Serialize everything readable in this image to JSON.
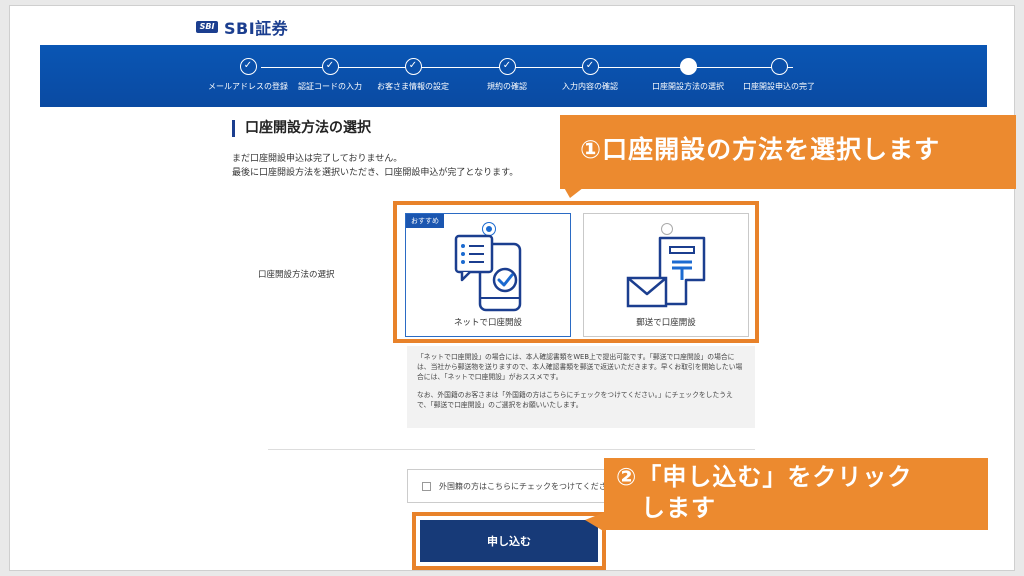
{
  "header": {
    "logo_mark": "SBI",
    "logo_text": "SBI証券"
  },
  "steps": [
    {
      "label": "メールアドレスの登録",
      "state": "done"
    },
    {
      "label": "認証コードの入力",
      "state": "done"
    },
    {
      "label": "お客さま情報の設定",
      "state": "done"
    },
    {
      "label": "規約の確認",
      "state": "done"
    },
    {
      "label": "入力内容の確認",
      "state": "done"
    },
    {
      "label": "口座開設方法の選択",
      "state": "current"
    },
    {
      "label": "口座開設申込の完了",
      "state": "future"
    }
  ],
  "main": {
    "title": "口座開設方法の選択",
    "intro_line1": "まだ口座開設申込は完了しておりません。",
    "intro_line2": "最後に口座開設方法を選択いただき、口座開設申込が完了となります。",
    "method_label": "口座開設方法の選択",
    "badge": "おすすめ",
    "option_net_label": "ネットで口座開設",
    "option_post_label": "郵送で口座開設",
    "selected_option": "net",
    "notes_p1": "「ネットで口座開設」の場合には、本人確認書類をWEB上で提出可能です。「郵送で口座開設」の場合には、当社から郵送物を送りますので、本人確認書類を郵送で返送いただきます。早くお取引を開始したい場合には、「ネットで口座開設」がおススメです。",
    "notes_p2": "なお、外国籍のお客さまは「外国籍の方はこちらにチェックをつけてください。」にチェックをしたうえで、「郵送で口座開設」のご選択をお願いいたします。",
    "foreign_checkbox_label": "外国籍の方はこちらにチェックをつけてください。",
    "foreign_checked": false,
    "submit_label": "申し込む"
  },
  "callouts": {
    "callout1": "①口座開設の方法を選択します",
    "callout2_line1": "②「申し込む」をクリック",
    "callout2_line2": "　します"
  },
  "colors": {
    "brand": "#1b3e8f",
    "progress_bar": "#0a50ab",
    "callout": "#ec8a2f",
    "submit_button": "#173a78"
  }
}
